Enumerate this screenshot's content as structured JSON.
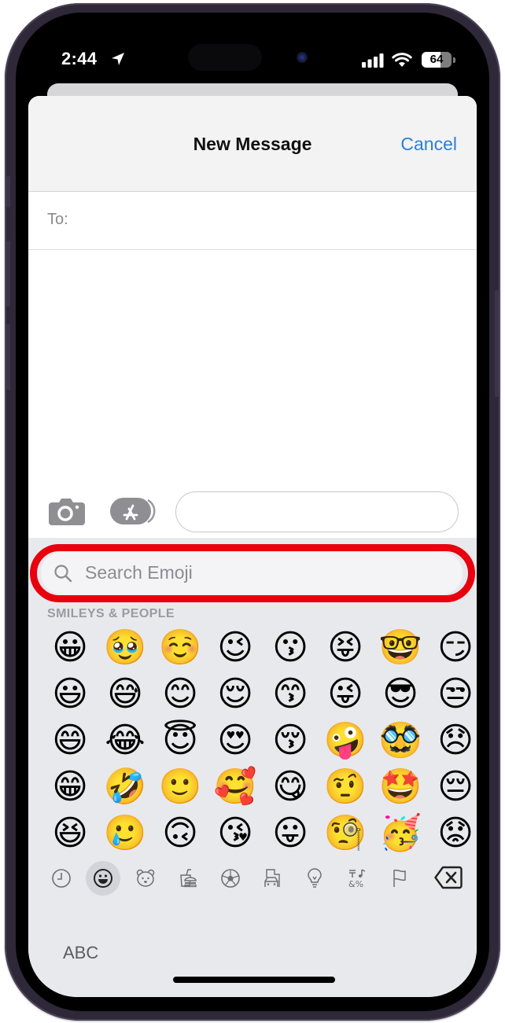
{
  "status_bar": {
    "time": "2:44",
    "location_icon": "location-arrow-icon",
    "signal_icon": "cellular-signal-icon",
    "wifi_icon": "wifi-icon",
    "battery_percent": "64",
    "battery_level": 0.64
  },
  "sheet": {
    "title": "New Message",
    "cancel_label": "Cancel",
    "to_label": "To:",
    "to_value": "",
    "message_value": "",
    "camera_icon": "camera-icon",
    "apps_icon": "app-store-icon"
  },
  "keyboard": {
    "search_placeholder": "Search Emoji",
    "search_value": "",
    "section_label": "SMILEYS & PEOPLE",
    "emoji_rows": [
      [
        "😀",
        "🥹",
        "☺️",
        "😉",
        "😗",
        "😝",
        "🤓",
        "😏"
      ],
      [
        "😃",
        "😅",
        "😊",
        "😌",
        "😙",
        "😜",
        "😎",
        "😒"
      ],
      [
        "😄",
        "😂",
        "😇",
        "😍",
        "😚",
        "🤪",
        "🥸",
        "😞"
      ],
      [
        "😁",
        "🤣",
        "🙂",
        "🥰",
        "😋",
        "🤨",
        "🤩",
        "😔"
      ],
      [
        "😆",
        "🥲",
        "🙃",
        "😘",
        "😛",
        "🧐",
        "🥳",
        "😟"
      ]
    ],
    "categories": [
      {
        "name": "frequently-used",
        "icon": "clock-icon",
        "active": false
      },
      {
        "name": "smileys-people",
        "icon": "smiley-icon",
        "active": true
      },
      {
        "name": "animals-nature",
        "icon": "bear-icon",
        "active": false
      },
      {
        "name": "food-drink",
        "icon": "burger-cup-icon",
        "active": false
      },
      {
        "name": "activity",
        "icon": "soccer-ball-icon",
        "active": false
      },
      {
        "name": "travel-places",
        "icon": "car-building-icon",
        "active": false
      },
      {
        "name": "objects",
        "icon": "lightbulb-icon",
        "active": false
      },
      {
        "name": "symbols",
        "icon": "symbols-icon",
        "active": false
      },
      {
        "name": "flags",
        "icon": "flag-icon",
        "active": false
      }
    ],
    "delete_icon": "delete-backspace-icon",
    "abc_label": "ABC"
  },
  "annotation": {
    "highlight_color": "#e8000e",
    "highlight_target": "search-emoji-field"
  },
  "colors": {
    "accent": "#2e7fd6",
    "keyboard_bg": "#e8e9ec",
    "nav_bg": "#f3f3f4"
  }
}
